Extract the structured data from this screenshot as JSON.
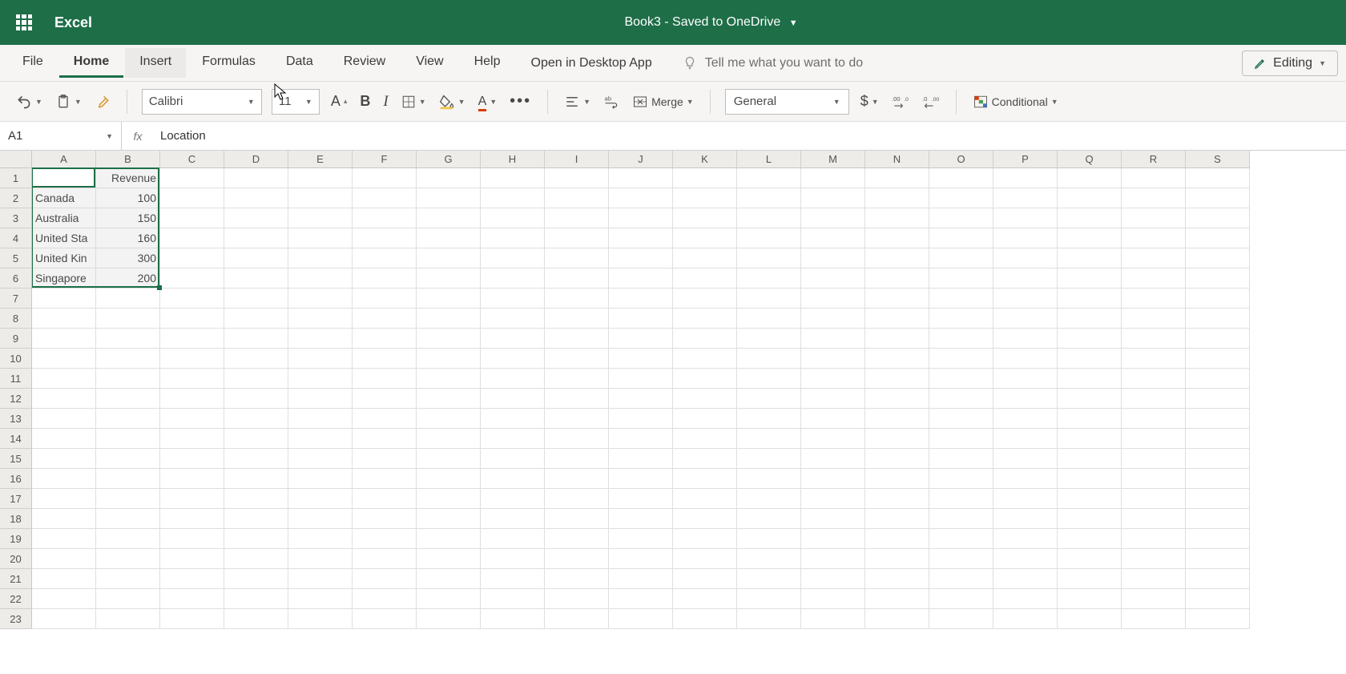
{
  "app": {
    "name": "Excel",
    "document_title": "Book3  -  Saved to OneDrive"
  },
  "tabs": {
    "file": "File",
    "home": "Home",
    "insert": "Insert",
    "formulas": "Formulas",
    "data": "Data",
    "review": "Review",
    "view": "View",
    "help": "Help"
  },
  "actions": {
    "open_desktop": "Open in Desktop App",
    "tell_me": "Tell me what you want to do",
    "editing": "Editing"
  },
  "toolbar": {
    "font_name": "Calibri",
    "font_size": "11",
    "merge": "Merge",
    "number_format": "General",
    "conditional": "Conditional"
  },
  "formula_bar": {
    "name_box": "A1",
    "fx": "fx",
    "value": "Location"
  },
  "columns": [
    "A",
    "B",
    "C",
    "D",
    "E",
    "F",
    "G",
    "H",
    "I",
    "J",
    "K",
    "L",
    "M",
    "N",
    "O",
    "P",
    "Q",
    "R",
    "S"
  ],
  "rows": 23,
  "grid": {
    "A1": "Location",
    "B1": "Revenue",
    "A2": "Canada",
    "B2": "100",
    "A3": "Australia",
    "B3": "150",
    "A4": "United Sta",
    "B4": "160",
    "A5": "United Kin",
    "B5": "300",
    "A6": "Singapore",
    "B6": "200"
  },
  "chart_data": {
    "type": "table",
    "headers": [
      "Location",
      "Revenue"
    ],
    "rows": [
      [
        "Canada",
        100
      ],
      [
        "Australia",
        150
      ],
      [
        "United States",
        160
      ],
      [
        "United Kingdom",
        300
      ],
      [
        "Singapore",
        200
      ]
    ]
  }
}
